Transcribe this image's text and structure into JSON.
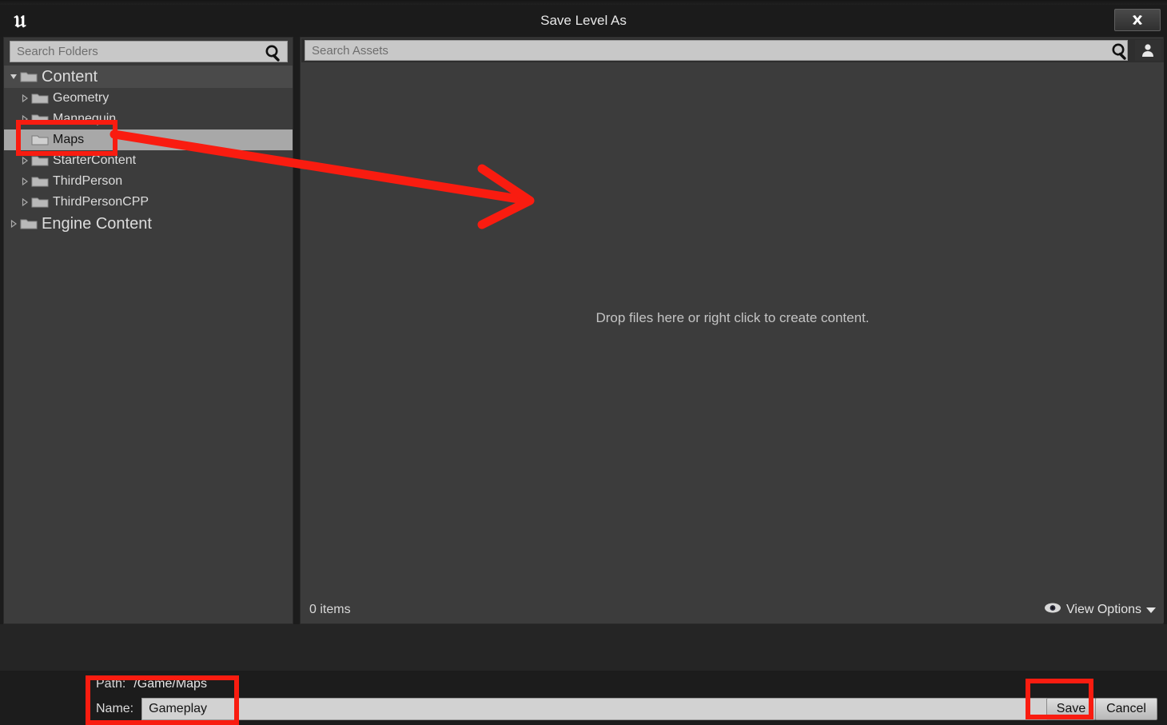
{
  "window": {
    "title": "Save Level As",
    "close_label": "×",
    "logo": "unreal-engine-logo"
  },
  "left_pane": {
    "search": {
      "placeholder": "Search Folders",
      "icon": "magnifier-icon"
    },
    "tree": [
      {
        "label": "Content",
        "level": 0,
        "expander": "expanded",
        "selected": false,
        "root": true
      },
      {
        "label": "Geometry",
        "level": 1,
        "expander": "collapsed",
        "selected": false,
        "root": false
      },
      {
        "label": "Mannequin",
        "level": 1,
        "expander": "collapsed",
        "selected": false,
        "root": false
      },
      {
        "label": "Maps",
        "level": 1,
        "expander": "none",
        "selected": true,
        "root": false
      },
      {
        "label": "StarterContent",
        "level": 1,
        "expander": "collapsed",
        "selected": false,
        "root": false
      },
      {
        "label": "ThirdPerson",
        "level": 1,
        "expander": "collapsed",
        "selected": false,
        "root": false
      },
      {
        "label": "ThirdPersonCPP",
        "level": 1,
        "expander": "collapsed",
        "selected": false,
        "root": false
      },
      {
        "label": "Engine Content",
        "level": 0,
        "expander": "collapsed",
        "selected": false,
        "root": true
      }
    ]
  },
  "right_pane": {
    "search": {
      "placeholder": "Search Assets",
      "icon": "magnifier-icon"
    },
    "user_icon": "user-profile-icon",
    "empty_message": "Drop files here or right click to create content.",
    "status": {
      "items_count": "0 items",
      "view_options_label": "View Options",
      "view_options_icon": "eye-icon",
      "view_options_caret": "chevron-down-icon"
    }
  },
  "footer": {
    "path_label": "Path:",
    "path_value": "/Game/Maps",
    "name_label": "Name:",
    "name_value": "Gameplay",
    "name_placeholder": "Gameplay",
    "save_label": "Save",
    "cancel_label": "Cancel"
  },
  "annotations": {
    "color": "#f91c10",
    "highlight_maps": "Maps folder highlight",
    "highlight_path_name": "Path and Name fields highlight",
    "highlight_save": "Save button highlight",
    "arrow": "arrow pointing from Maps folder to asset area"
  }
}
